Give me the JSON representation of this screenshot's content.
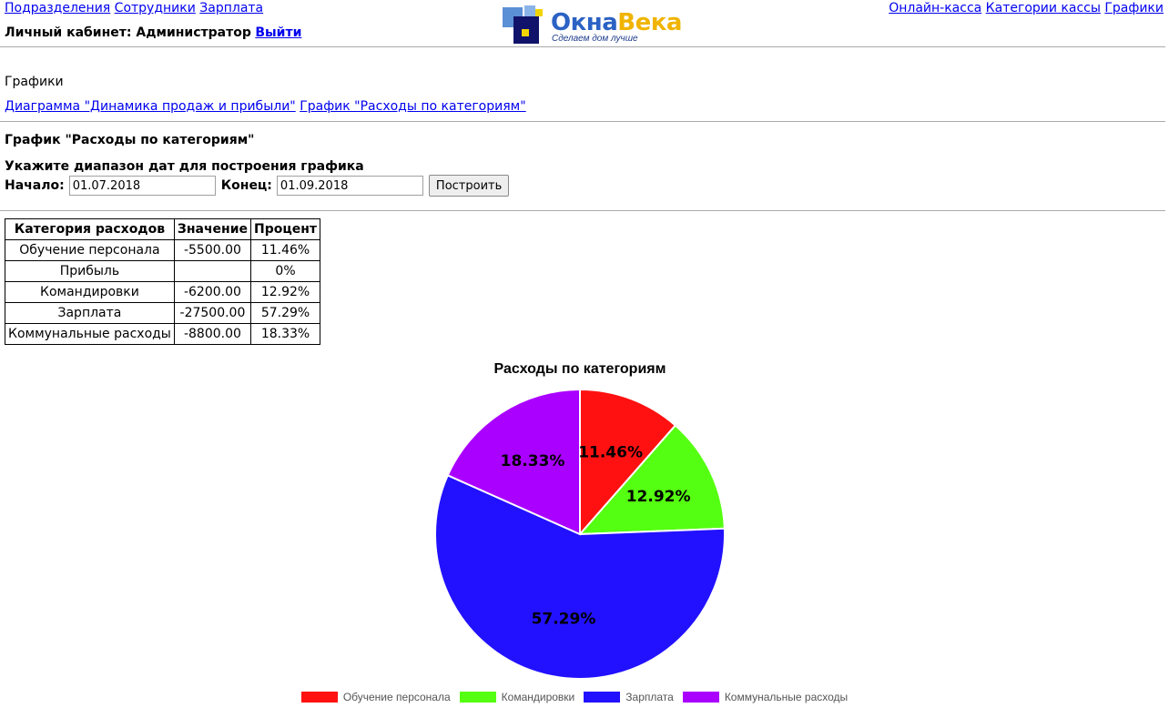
{
  "header": {
    "nav_left": [
      "Подразделения",
      "Сотрудники",
      "Зарплата"
    ],
    "cabinet_prefix": "Личный кабинет: Администратор",
    "logout": "Выйти",
    "nav_right": [
      "Онлайн-касса",
      "Категории кассы",
      "Графики"
    ],
    "logo": {
      "word_part1": "Окна",
      "word_part2": "Века",
      "tagline": "Сделаем дом лучше"
    }
  },
  "section": {
    "title": "Графики",
    "links": [
      "Диаграмма \"Динамика продаж и прибыли\"",
      "График \"Расходы по категориям\""
    ]
  },
  "report": {
    "title": "График \"Расходы по категориям\"",
    "range_prompt": "Укажите диапазон дат для построения графика",
    "start_label": "Начало:",
    "start_value": "01.07.2018",
    "end_label": "Конец:",
    "end_value": "01.09.2018",
    "build_button": "Построить"
  },
  "table": {
    "headers": [
      "Категория расходов",
      "Значение",
      "Процент"
    ],
    "rows": [
      [
        "Обучение персонала",
        "-5500.00",
        "11.46%"
      ],
      [
        "Прибыль",
        "",
        "0%"
      ],
      [
        "Командировки",
        "-6200.00",
        "12.92%"
      ],
      [
        "Зарплата",
        "-27500.00",
        "57.29%"
      ],
      [
        "Коммунальные расходы",
        "-8800.00",
        "18.33%"
      ]
    ]
  },
  "chart_data": {
    "type": "pie",
    "title": "Расходы по категориям",
    "categories": [
      "Обучение персонала",
      "Командировки",
      "Зарплата",
      "Коммунальные расходы"
    ],
    "values": [
      11.46,
      12.92,
      57.29,
      18.33
    ],
    "labels": [
      "11.46%",
      "12.92%",
      "57.29%",
      "18.33%"
    ],
    "colors": [
      "#ff1111",
      "#55ff11",
      "#2211ff",
      "#aa00ff"
    ],
    "legend": "bottom"
  }
}
